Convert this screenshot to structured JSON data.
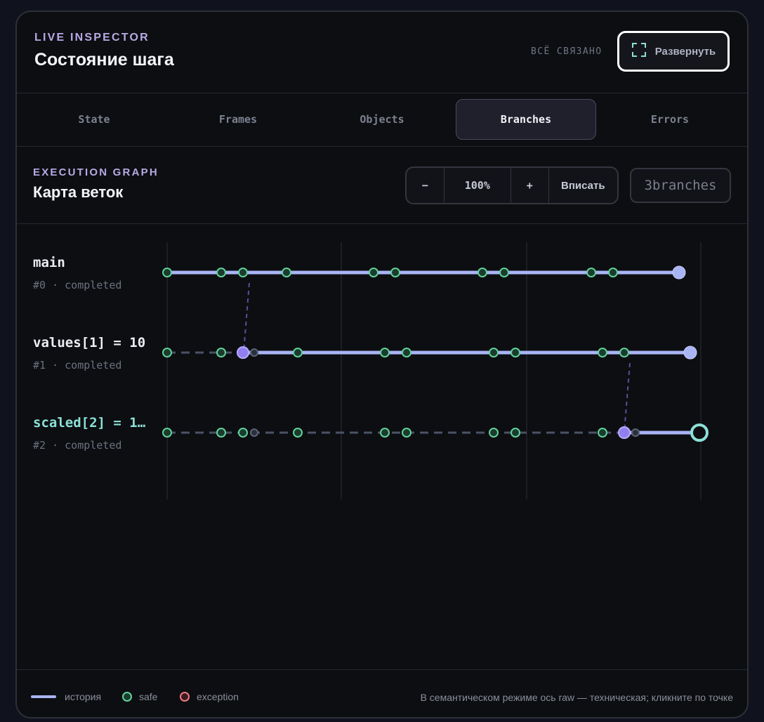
{
  "header": {
    "eyebrow": "LIVE INSPECTOR",
    "title": "Состояние шага",
    "sync_status": "ВСЁ СВЯЗАНО",
    "expand_label": "Развернуть"
  },
  "tabs": [
    {
      "label": "State",
      "active": false
    },
    {
      "label": "Frames",
      "active": false
    },
    {
      "label": "Objects",
      "active": false
    },
    {
      "label": "Branches",
      "active": true
    },
    {
      "label": "Errors",
      "active": false
    }
  ],
  "graph_header": {
    "eyebrow": "EXECUTION GRAPH",
    "title": "Карта веток",
    "zoom_out": "−",
    "zoom_level": "100%",
    "zoom_in": "+",
    "fit_label": "Вписать",
    "branch_count": "3branches"
  },
  "branches": [
    {
      "name": "main",
      "meta": "#0 · completed",
      "current": false
    },
    {
      "name": "values[1] = 10",
      "meta": "#1 · completed",
      "current": false
    },
    {
      "name": "scaled[2] = 1…",
      "meta": "#2 · completed",
      "current": true
    }
  ],
  "legend": {
    "history": "история",
    "safe": "safe",
    "exception": "exception",
    "hint": "В семантическом режиме ось raw — техническая; кликните по точке"
  },
  "colors": {
    "history": "#a9b4f5",
    "safe": "#5fd39a",
    "exception": "#f07a84",
    "fork": "#8f7ff0",
    "current": "#8ce0d8"
  }
}
